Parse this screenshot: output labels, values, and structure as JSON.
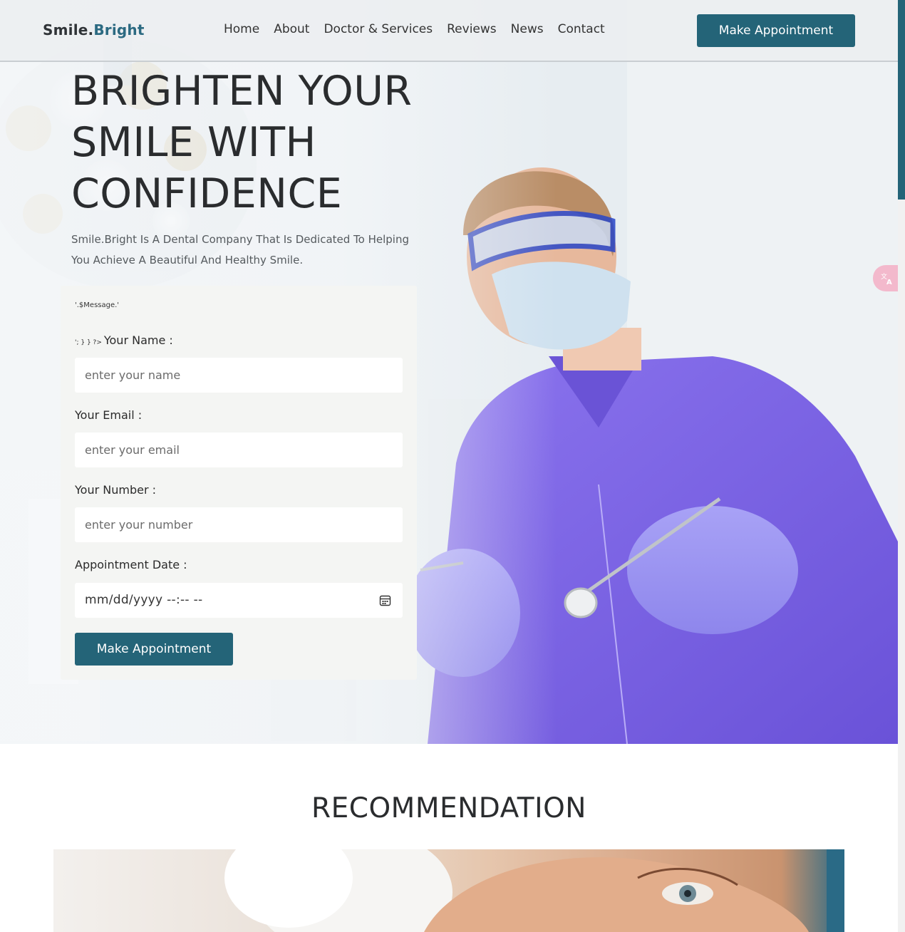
{
  "header": {
    "logo_main": "Smile.",
    "logo_accent": "Bright",
    "nav": [
      "Home",
      "About",
      "Doctor & Services",
      "Reviews",
      "News",
      "Contact"
    ],
    "cta_label": "Make Appointment"
  },
  "hero": {
    "title_lines": [
      "BRIGHTEN YOUR",
      "SMILE WITH",
      "CONFIDENCE"
    ],
    "subtitle": "Smile.Bright Is A Dental Company That Is Dedicated To Helping You Achieve A Beautiful And Healthy Smile."
  },
  "form": {
    "message_placeholder": "'.$Message.'",
    "php_fragment": "'; } } ?>",
    "name_label": "Your Name :",
    "name_placeholder": "enter your name",
    "email_label": "Your Email :",
    "email_placeholder": "enter your email",
    "number_label": "Your Number :",
    "number_placeholder": "enter your number",
    "date_label": "Appointment Date :",
    "date_value": "mm/dd/yyyy --:-- --",
    "submit_label": "Make Appointment"
  },
  "recommendation": {
    "title": "RECOMMENDATION"
  },
  "colors": {
    "accent": "#246478",
    "scrub_purple": "#7a62e6",
    "translate_widget": "#f3b9cc"
  },
  "icons": {
    "calendar": "calendar-icon",
    "translate": "translate-icon"
  }
}
